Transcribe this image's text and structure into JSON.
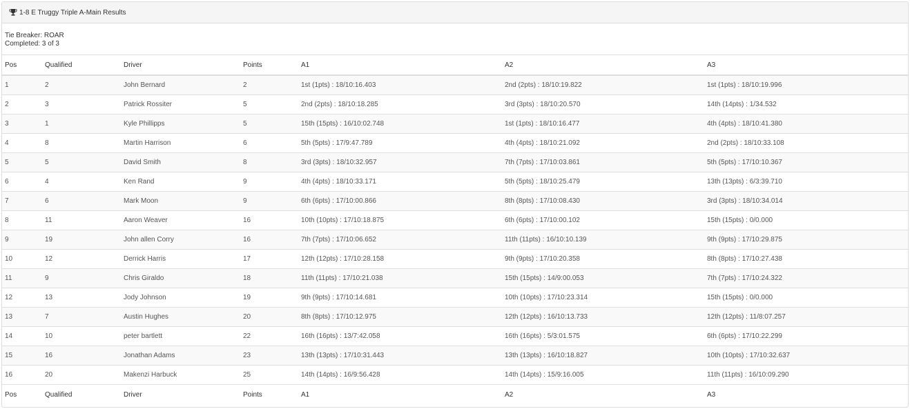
{
  "panel": {
    "title": "1-8 E Truggy Triple A-Main Results",
    "tie_breaker": "Tie Breaker: ROAR",
    "completed": "Completed: 3 of 3"
  },
  "columns": [
    "Pos",
    "Qualified",
    "Driver",
    "Points",
    "A1",
    "A2",
    "A3"
  ],
  "rows": [
    [
      "1",
      "2",
      "John Bernard",
      "2",
      "1st (1pts) : 18/10:16.403",
      "2nd (2pts) : 18/10:19.822",
      "1st (1pts) : 18/10:19.996"
    ],
    [
      "2",
      "3",
      "Patrick Rossiter",
      "5",
      "2nd (2pts) : 18/10:18.285",
      "3rd (3pts) : 18/10:20.570",
      "14th (14pts) : 1/34.532"
    ],
    [
      "3",
      "1",
      "Kyle Phillipps",
      "5",
      "15th (15pts) : 16/10:02.748",
      "1st (1pts) : 18/10:16.477",
      "4th (4pts) : 18/10:41.380"
    ],
    [
      "4",
      "8",
      "Martin Harrison",
      "6",
      "5th (5pts) : 17/9:47.789",
      "4th (4pts) : 18/10:21.092",
      "2nd (2pts) : 18/10:33.108"
    ],
    [
      "5",
      "5",
      "David Smith",
      "8",
      "3rd (3pts) : 18/10:32.957",
      "7th (7pts) : 17/10:03.861",
      "5th (5pts) : 17/10:10.367"
    ],
    [
      "6",
      "4",
      "Ken Rand",
      "9",
      "4th (4pts) : 18/10:33.171",
      "5th (5pts) : 18/10:25.479",
      "13th (13pts) : 6/3:39.710"
    ],
    [
      "7",
      "6",
      "Mark Moon",
      "9",
      "6th (6pts) : 17/10:00.866",
      "8th (8pts) : 17/10:08.430",
      "3rd (3pts) : 18/10:34.014"
    ],
    [
      "8",
      "11",
      "Aaron Weaver",
      "16",
      "10th (10pts) : 17/10:18.875",
      "6th (6pts) : 17/10:00.102",
      "15th (15pts) : 0/0.000"
    ],
    [
      "9",
      "19",
      "John allen Corry",
      "16",
      "7th (7pts) : 17/10:06.652",
      "11th (11pts) : 16/10:10.139",
      "9th (9pts) : 17/10:29.875"
    ],
    [
      "10",
      "12",
      "Derrick Harris",
      "17",
      "12th (12pts) : 17/10:28.158",
      "9th (9pts) : 17/10:20.358",
      "8th (8pts) : 17/10:27.438"
    ],
    [
      "11",
      "9",
      "Chris Giraldo",
      "18",
      "11th (11pts) : 17/10:21.038",
      "15th (15pts) : 14/9:00.053",
      "7th (7pts) : 17/10:24.322"
    ],
    [
      "12",
      "13",
      "Jody Johnson",
      "19",
      "9th (9pts) : 17/10:14.681",
      "10th (10pts) : 17/10:23.314",
      "15th (15pts) : 0/0.000"
    ],
    [
      "13",
      "7",
      "Austin Hughes",
      "20",
      "8th (8pts) : 17/10:12.975",
      "12th (12pts) : 16/10:13.733",
      "12th (12pts) : 11/8:07.257"
    ],
    [
      "14",
      "10",
      "peter bartlett",
      "22",
      "16th (16pts) : 13/7:42.058",
      "16th (16pts) : 5/3:01.575",
      "6th (6pts) : 17/10:22.299"
    ],
    [
      "15",
      "16",
      "Jonathan Adams",
      "23",
      "13th (13pts) : 17/10:31.443",
      "13th (13pts) : 16/10:18.827",
      "10th (10pts) : 17/10:32.637"
    ],
    [
      "16",
      "20",
      "Makenzi Harbuck",
      "25",
      "14th (14pts) : 16/9:56.428",
      "14th (14pts) : 15/9:16.005",
      "11th (11pts) : 16/10:09.290"
    ]
  ],
  "icons": {
    "title_icon": "trophy-icon"
  },
  "colors": {
    "header_bg": "#f5f5f5",
    "stripe_bg": "#f9f9f9",
    "border": "#dddddd"
  }
}
